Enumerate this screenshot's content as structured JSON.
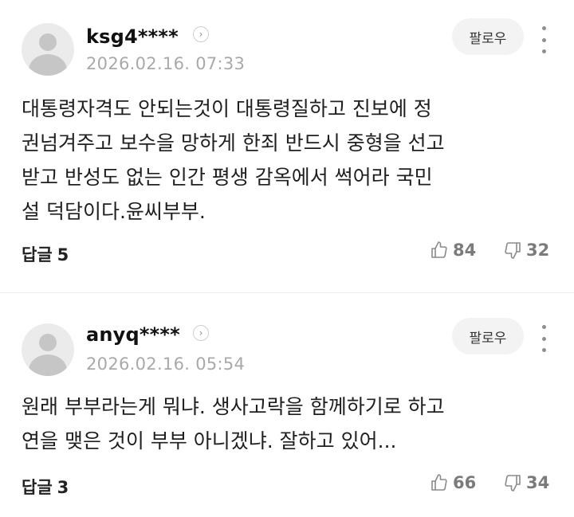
{
  "comments": [
    {
      "username": "ksg4****",
      "timestamp": "2026.02.16. 07:33",
      "follow_label": "팔로우",
      "lines": [
        "대통령자격도 안되는것이 대통령질하고 진보에 정",
        "권넘겨주고 보수을 망하게 한죄 반드시 중형을 선고",
        "받고 반성도 없는 인간 평생 감옥에서 썩어라 국민",
        "설 덕담이다.윤씨부부."
      ],
      "reply_label": "답글",
      "reply_count": "5",
      "likes": "84",
      "dislikes": "32"
    },
    {
      "username": "anyq****",
      "timestamp": "2026.02.16. 05:54",
      "follow_label": "팔로우",
      "lines": [
        "원래 부부라는게 뭐냐. 생사고락을 함께하기로 하고",
        "연을 맺은 것이 부부 아니겠냐. 잘하고 있어..."
      ],
      "reply_label": "답글",
      "reply_count": "3",
      "likes": "66",
      "dislikes": "34"
    }
  ],
  "icons": {
    "profile_arrow": "chevron-right-icon",
    "more": "more-vertical-icon",
    "like": "thumbs-up-icon",
    "dislike": "thumbs-down-icon"
  }
}
